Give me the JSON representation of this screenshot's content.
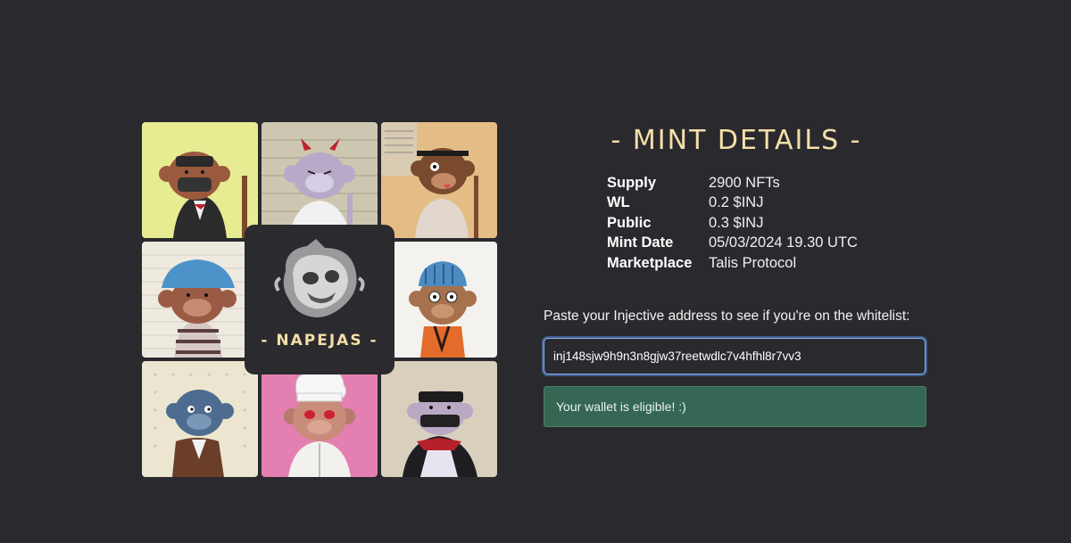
{
  "collection": {
    "logo_text": "- NAPEJAS -",
    "tiles": [
      {
        "name": "tile-masked-monkey-suit",
        "bg": "#e7ec93"
      },
      {
        "name": "tile-horned-monkey",
        "bg": "#cdc7b1"
      },
      {
        "name": "tile-eyepatch-monkey",
        "bg": "#e4bd86"
      },
      {
        "name": "tile-bucket-hat-monkey",
        "bg": "#efeae0"
      },
      {
        "name": "tile-beanie-monkey",
        "bg": "#f4f2ee"
      },
      {
        "name": "tile-blue-monkey",
        "bg": "#ece6d0"
      },
      {
        "name": "tile-chef-monkey",
        "bg": "#e47fb1"
      },
      {
        "name": "tile-bandit-monkey",
        "bg": "#d9cfbd"
      }
    ]
  },
  "mint": {
    "title": "- MINT DETAILS -",
    "details": [
      {
        "key": "Supply",
        "value": "2900 NFTs"
      },
      {
        "key": "WL",
        "value": "0.2 $INJ"
      },
      {
        "key": "Public",
        "value": "0.3 $INJ"
      },
      {
        "key": "Mint Date",
        "value": "05/03/2024 19.30 UTC"
      },
      {
        "key": "Marketplace",
        "value": "Talis Protocol"
      }
    ]
  },
  "whitelist": {
    "prompt": "Paste your Injective address to see if you're on the whitelist:",
    "address_value": "inj148sjw9h9n3n8gjw37reetwdlc7v4hfhl8r7vv3",
    "result": "Your wallet is eligible! :)"
  },
  "colors": {
    "background": "#2a292e",
    "accent": "#f4e0a8",
    "success": "#356754",
    "focus": "#8ab4f0"
  }
}
